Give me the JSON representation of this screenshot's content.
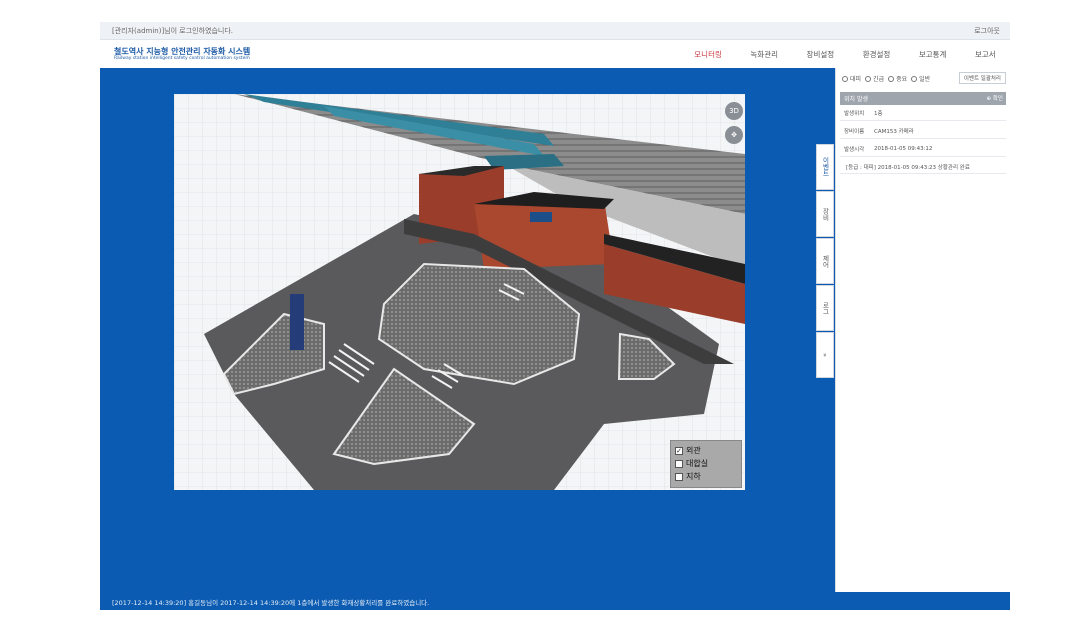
{
  "topbar": {
    "admin_message": "[관리자(admin)]님이 로그인하였습니다.",
    "logout_label": "로그아웃"
  },
  "header": {
    "title": "철도역사 지능형 안전관리 자동화 시스템",
    "subtitle": "Railway station intelligent safety control automation system"
  },
  "nav": {
    "items": [
      "모니터링",
      "녹화관리",
      "장비설정",
      "환경설정",
      "보고통계",
      "보고서"
    ],
    "active_index": 0
  },
  "viewport": {
    "btn_3d": "3D",
    "layers": [
      {
        "label": "외관",
        "checked": true
      },
      {
        "label": "대합실",
        "checked": false
      },
      {
        "label": "지하",
        "checked": false
      }
    ]
  },
  "side_tabs": [
    "이벤트",
    "장비",
    "제어",
    "로그",
    "»"
  ],
  "panel": {
    "radios": [
      "대피",
      "긴급",
      "중요",
      "일반"
    ],
    "confirm_button": "이벤트 일괄처리",
    "event_header": "위치 발생",
    "event_check": "⊕ 확인",
    "rows": [
      {
        "label": "발생위치",
        "value": "1층"
      },
      {
        "label": "장비이름",
        "value": "CAM153 카메라"
      },
      {
        "label": "발생시각",
        "value": "2018-01-05 09:43:12"
      }
    ],
    "note": "[등급 : 대피] 2018-01-05 09:43:23 상황관리 완료"
  },
  "statusbar": {
    "text": "[2017-12-14 14:39:20] 홍길동님이 2017-12-14 14:39:20에 1층에서 발생한 화재상황처리를 완료하였습니다."
  },
  "colors": {
    "main_blue": "#0a5bb1",
    "nav_active": "#c8323c",
    "brick": "#9a3d2a",
    "platform_roof": "#2f7f96",
    "asphalt": "#5a5a5c"
  }
}
